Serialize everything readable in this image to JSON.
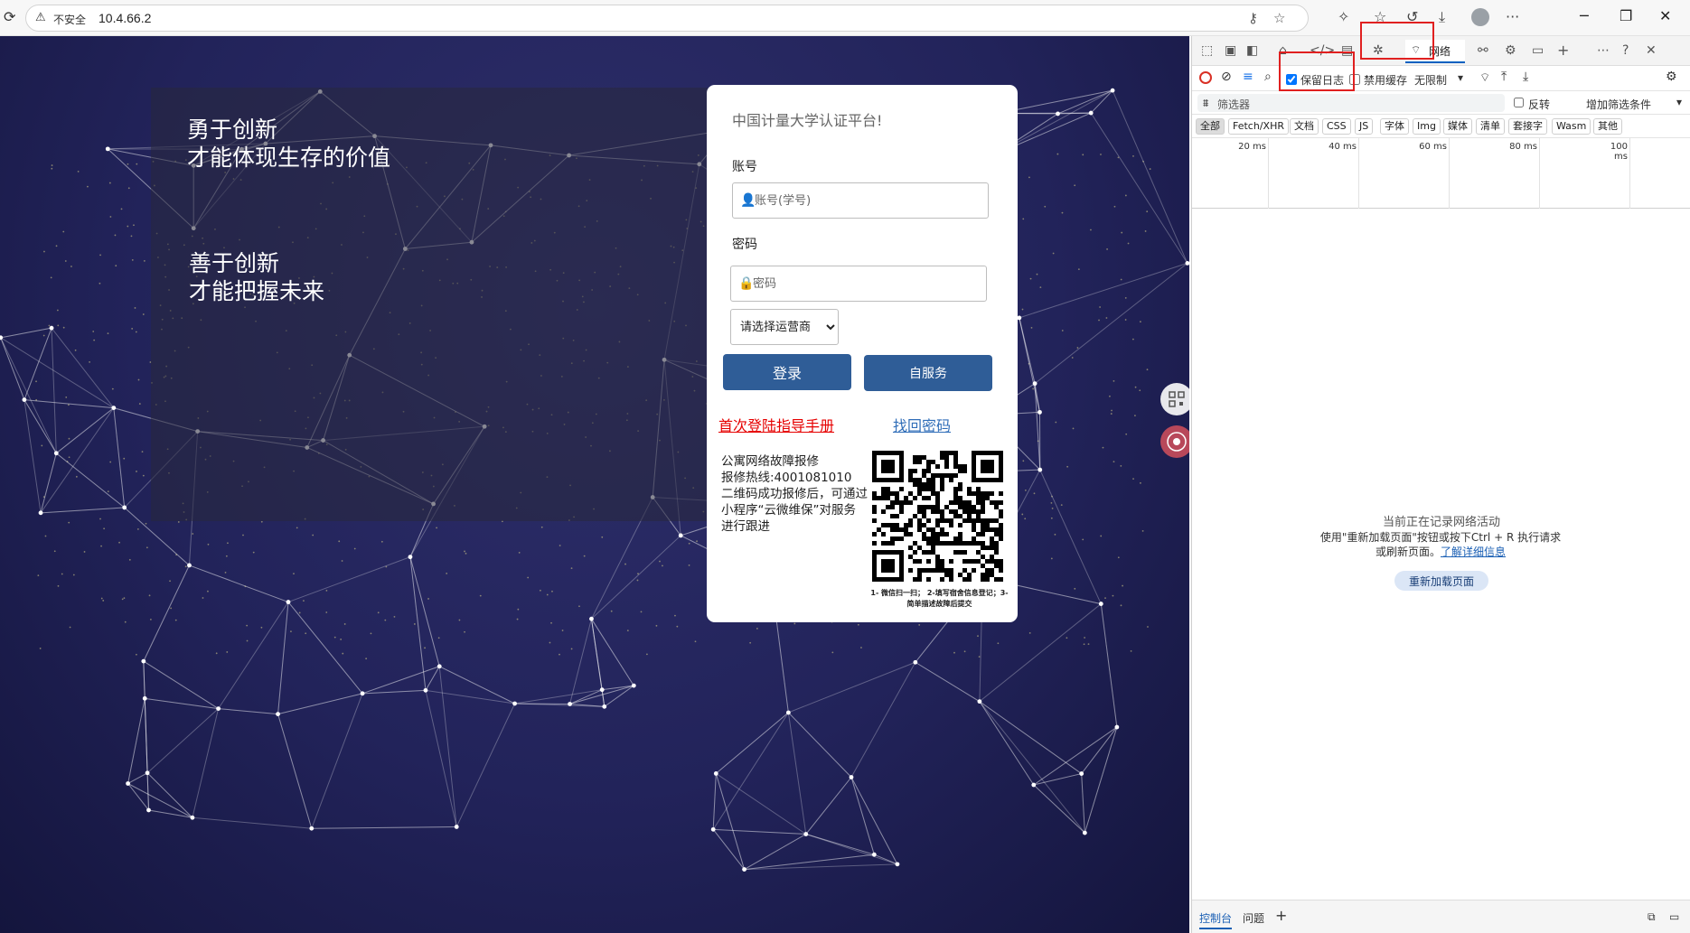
{
  "browser": {
    "security_label": "不安全",
    "url": "10.4.66.2",
    "menu_glyph": "···"
  },
  "page": {
    "slogan1": [
      "勇于创新",
      "才能体现生存的价值"
    ],
    "slogan2": [
      "善于创新",
      "才能把握未来"
    ],
    "login": {
      "title": "中国计量大学认证平台!",
      "account_label": "账号",
      "account_placeholder": "账号(学号)",
      "password_label": "密码",
      "password_placeholder": "密码",
      "carrier_selected": "请选择运营商",
      "login_button": "登录",
      "selfservice_button": "自服务",
      "guide_link": "首次登陆指导手册",
      "find_password_link": "找回密码",
      "repair_info": "公寓网络故障报修\n报修热线:4001081010\n二维码成功报修后，可通过小程序“云微维保”对服务进行跟进",
      "qr_caption": "1- 微信扫一扫； 2-填写宿舍信息登记；3- 简单描述故障后提交"
    }
  },
  "devtools": {
    "network_tab": "网络",
    "preserve_log": "保留日志",
    "preserve_log_checked": true,
    "disable_cache": "禁用缓存",
    "throttle": "无限制",
    "filter_placeholder": "筛选器",
    "invert": "反转",
    "more_filters": "增加筛选条件",
    "types": [
      "全部",
      "Fetch/XHR",
      "文档",
      "CSS",
      "JS",
      "字体",
      "Img",
      "媒体",
      "清单",
      "套接字",
      "Wasm",
      "其他"
    ],
    "ticks": [
      "20 ms",
      "40 ms",
      "60 ms",
      "80 ms",
      "100 ms"
    ],
    "empty_title": "当前正在记录网络活动",
    "empty_desc": "使用\"重新加载页面\"按钮或按下Ctrl + R 执行请求或刷新页面。",
    "learn_more": "了解详细信息",
    "reload_button": "重新加载页面",
    "drawer_tabs": [
      "控制台",
      "问题"
    ]
  },
  "colors": {
    "login_button": "#2f5d97",
    "guide_link": "#e60000",
    "highlight_box": "#e02020"
  }
}
